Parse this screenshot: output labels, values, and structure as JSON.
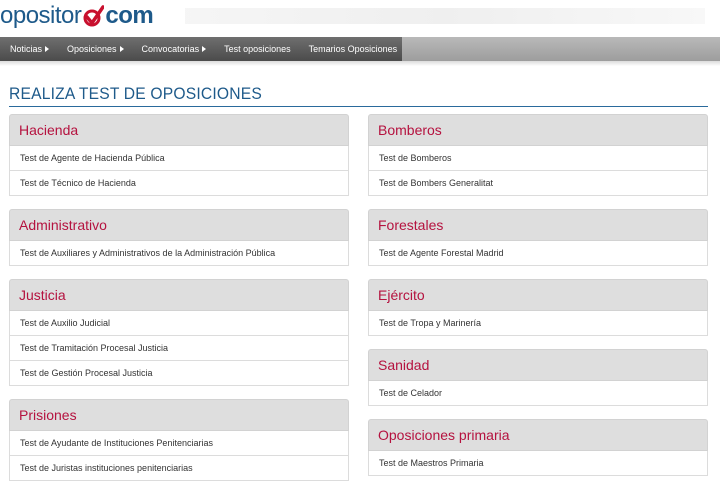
{
  "logo": {
    "part1": "opositor",
    "part2": "com"
  },
  "nav": {
    "items": [
      {
        "label": "Noticias",
        "has_caret": true
      },
      {
        "label": "Oposiciones",
        "has_caret": true
      },
      {
        "label": "Convocatorias",
        "has_caret": true
      },
      {
        "label": "Test oposiciones",
        "has_caret": false
      },
      {
        "label": "Temarios Oposiciones",
        "has_caret": false
      }
    ]
  },
  "page_title": "REALIZA TEST DE OPOSICIONES",
  "colors": {
    "brand_blue": "#1e5a8a",
    "category_red": "#b5123f",
    "logo_check_red": "#c8102e"
  },
  "left_column": [
    {
      "title": "Hacienda",
      "links": [
        "Test de Agente de Hacienda Pública",
        "Test de Técnico de Hacienda"
      ]
    },
    {
      "title": "Administrativo",
      "links": [
        "Test de Auxiliares y Administrativos de la Administración Pública"
      ]
    },
    {
      "title": "Justicia",
      "links": [
        "Test de Auxilio Judicial",
        "Test de Tramitación Procesal Justicia",
        "Test de Gestión Procesal Justicia"
      ]
    },
    {
      "title": "Prisiones",
      "links": [
        "Test de Ayudante de Instituciones Penitenciarias",
        "Test de Juristas instituciones penitenciarias"
      ]
    }
  ],
  "right_column": [
    {
      "title": "Bomberos",
      "links": [
        "Test de Bomberos",
        "Test de Bombers Generalitat"
      ]
    },
    {
      "title": "Forestales",
      "links": [
        "Test de Agente Forestal Madrid"
      ]
    },
    {
      "title": "Ejército",
      "links": [
        "Test de Tropa y Marinería"
      ]
    },
    {
      "title": "Sanidad",
      "links": [
        "Test de Celador"
      ]
    },
    {
      "title": "Oposiciones primaria",
      "links": [
        "Test de Maestros Primaria"
      ]
    }
  ]
}
